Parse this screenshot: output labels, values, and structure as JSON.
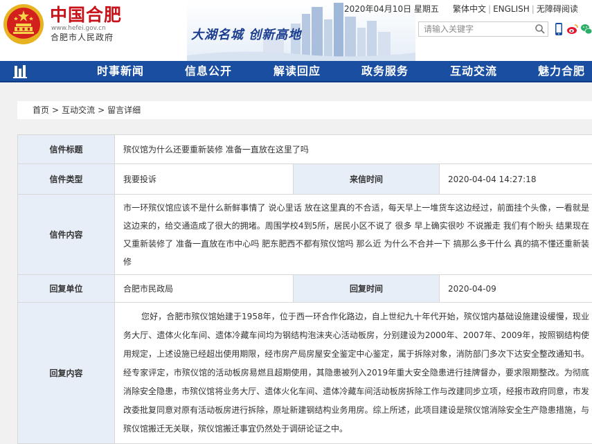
{
  "header": {
    "site_title": "中国合肥",
    "site_url": "www.hefei.gov.cn",
    "site_gov": "合肥市人民政府",
    "slogan": "大湖名城  创新高地",
    "date": "2020年04月10日  星期五",
    "links": [
      "繁体中文",
      "ENGLISH",
      "无障碍阅读"
    ],
    "search_placeholder": "请输入关键字",
    "colors": {
      "brand_red": "#c8121a",
      "nav_blue": "#1a4ea1",
      "slogan_blue": "#1a3d8f"
    }
  },
  "nav": {
    "items": [
      "时事新闻",
      "信息公开",
      "解读回应",
      "政务服务",
      "互动交流",
      "魅力合肥"
    ]
  },
  "breadcrumb": [
    "首页",
    "互动交流",
    "留言详细"
  ],
  "detail": {
    "title_label": "信件标题",
    "title_value": "殡仪馆为什么还要重新装修 准备一直放在这里了吗",
    "type_label": "信件类型",
    "type_value": "我要投诉",
    "time_label": "来信时间",
    "time_value": "2020-04-04 14:27:18",
    "content_label": "信件内容",
    "content_value": "市一环殡仪馆应该不是什么新鲜事情了 说心里话 放在这里真的不合适，每天早上一堆货车这边经过，前面挂个头像，一看就是这边来的，给交通造成了很大的拥堵。周围学校4到5所，居民小区不说了 很多 早上确实很吵 不说搬走 我们有个盼头 结果现在又重新装修了 准备一直放在市中心吗 肥东肥西不都有殡仪馆吗 那么近 为什么不合并一下 搞那么多干什么 真的搞不懂还重新装修",
    "unit_label": "回复单位",
    "unit_value": "合肥市民政局",
    "reply_time_label": "回复时间",
    "reply_time_value": "2020-04-09",
    "reply_label": "回复内容",
    "reply_value": "您好，合肥市殡仪馆始建于1958年，位于西一环合作化路边，自上世纪九十年代开始，殡仪馆内基础设施建设缓慢，现业务大厅、遗体火化车间、遗体冷藏车间均为钢结构泡沫夹心活动板房，分别建设为2000年、2007年、2009年，按照钢结构使用规定，上述设施已经超出使用期限，经市房产局房屋安全鉴定中心鉴定，属于拆除对象，消防部门多次下达安全整改通知书。经专家评定，市殡仪馆的活动板房易燃且超期使用，其隐患被列入2019年重大安全隐患进行挂牌督办，要求限期整改。为彻底消除安全隐患，市殡仪馆将业务大厅、遗体火化车间、遗体冷藏车间活动板房拆除工作与改建同步立项，经报市政府同意，市发改委批复同意对原有活动板房进行拆除，原址新建钢结构业务用房。综上所述，此项目建设是殡仪馆消除安全生产隐患措施，与殡仪馆搬迁无关联，殡仪馆搬迁事宜仍然处于调研论证之中。"
  }
}
